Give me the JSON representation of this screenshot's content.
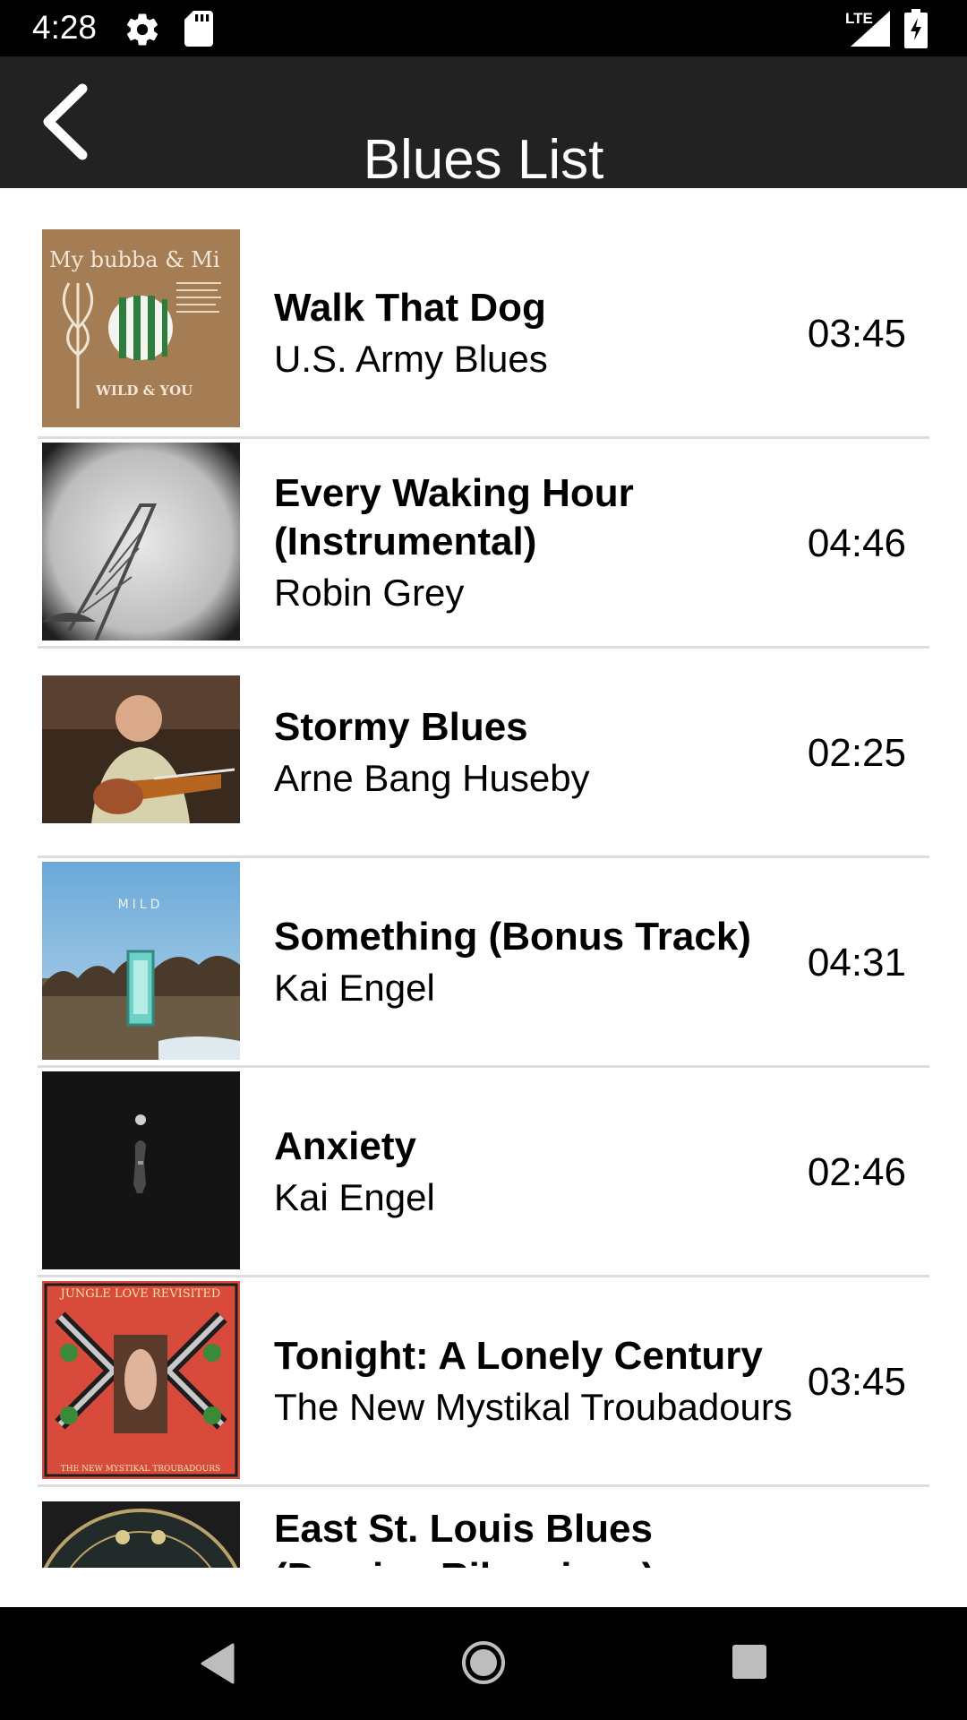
{
  "status_bar": {
    "time": "4:28",
    "network": "LTE",
    "icons": [
      "gear-icon",
      "sd-card-icon",
      "signal-icon",
      "battery-charging-icon"
    ]
  },
  "app_bar": {
    "title": "Blues List",
    "back_icon": "chevron-left-icon"
  },
  "songs": [
    {
      "title": "Walk That Dog",
      "artist": "U.S. Army Blues",
      "duration": "03:45",
      "art_label_1": "My bubba & Mi",
      "art_label_2": "WILD & YOU"
    },
    {
      "title": "Every Waking Hour (Instrumental)",
      "artist": "Robin Grey",
      "duration": "04:46"
    },
    {
      "title": "Stormy Blues",
      "artist": "Arne Bang Huseby",
      "duration": "02:25"
    },
    {
      "title": "Something (Bonus Track)",
      "artist": "Kai Engel",
      "duration": "04:31",
      "art_label_1": "MILD"
    },
    {
      "title": "Anxiety",
      "artist": "Kai Engel",
      "duration": "02:46"
    },
    {
      "title": "Tonight: A Lonely Century",
      "artist": "The New Mystikal Troubadours",
      "duration": "03:45",
      "art_label_1": "JUNGLE LOVE REVISITED",
      "art_label_2": "THE NEW MYSTIKAL TROUBADOURS"
    },
    {
      "title": "East St. Louis Blues (Damien Riba piano)",
      "artist": "",
      "duration": ""
    }
  ],
  "nav_bar": {
    "icons": [
      "nav-back-icon",
      "nav-home-icon",
      "nav-recents-icon"
    ]
  },
  "colors": {
    "status_bar": "#000000",
    "app_bar": "#222222",
    "divider": "#dddddd",
    "nav_bar": "#000000"
  }
}
